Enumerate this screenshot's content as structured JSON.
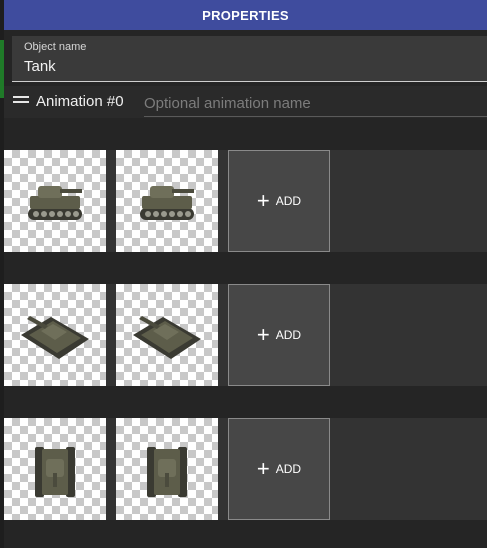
{
  "panel": {
    "title": "PROPERTIES"
  },
  "object_name": {
    "label": "Object name",
    "value": "Tank"
  },
  "animation": {
    "title": "Animation #0",
    "name_placeholder": "Optional animation name"
  },
  "directions": [
    {
      "frames": [
        "tank-side-sprite",
        "tank-side-sprite"
      ],
      "add_label": "ADD"
    },
    {
      "frames": [
        "tank-diagonal-sprite",
        "tank-diagonal-sprite"
      ],
      "add_label": "ADD"
    },
    {
      "frames": [
        "tank-front-sprite",
        "tank-front-sprite"
      ],
      "add_label": "ADD"
    }
  ],
  "colors": {
    "title_bar": "#3f4c9e",
    "panel_bg": "#252525",
    "row_bg": "#333333"
  }
}
